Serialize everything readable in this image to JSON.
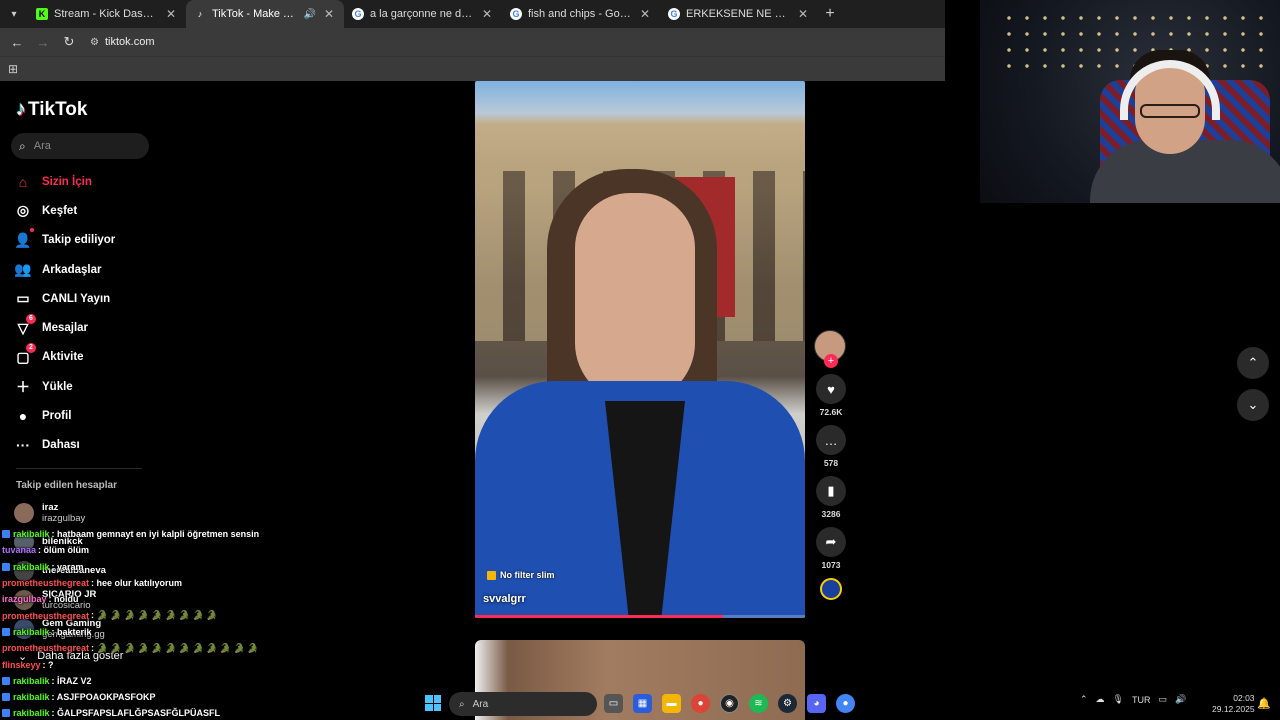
{
  "browser": {
    "tabs": [
      {
        "label": "Stream - Kick Dashboard",
        "icon": "kick-icon",
        "color": "#53fc18"
      },
      {
        "label": "TikTok - Make Your Day",
        "icon": "tiktok-icon",
        "color": "#ffffff",
        "active": true
      },
      {
        "label": "a la garçonne ne demek amk -",
        "icon": "google-icon",
        "color": "#4285f4"
      },
      {
        "label": "fish and chips - Google'da Ara",
        "icon": "google-icon",
        "color": "#4285f4"
      },
      {
        "label": "ERKEKSENE NE DEMEK - Googl",
        "icon": "google-icon",
        "color": "#4285f4"
      }
    ],
    "url": "tiktok.com"
  },
  "sidebar": {
    "brand": "TikTok",
    "search_placeholder": "Ara",
    "items": [
      {
        "label": "Sizin İçin",
        "icon": "home-icon",
        "active": true
      },
      {
        "label": "Keşfet",
        "icon": "compass-icon"
      },
      {
        "label": "Takip ediliyor",
        "icon": "following-icon",
        "dot": true
      },
      {
        "label": "Arkadaşlar",
        "icon": "friends-icon"
      },
      {
        "label": "CANLI Yayın",
        "icon": "live-icon"
      },
      {
        "label": "Mesajlar",
        "icon": "messages-icon",
        "badge": "6"
      },
      {
        "label": "Aktivite",
        "icon": "activity-icon",
        "badge": "2"
      },
      {
        "label": "Yükle",
        "icon": "upload-icon"
      },
      {
        "label": "Profil",
        "icon": "profile-icon"
      },
      {
        "label": "Dahası",
        "icon": "more-icon"
      }
    ],
    "following_title": "Takip edilen hesaplar",
    "following": [
      {
        "user": "iraz",
        "name": "irazgulbay"
      },
      {
        "user": "bilenikck",
        "name": ""
      },
      {
        "user": "therealbaneva",
        "name": ""
      },
      {
        "user": "SICARIO JR",
        "name": "turcosicario"
      },
      {
        "user": "Gem Gaming",
        "name": "gemgaming.gg"
      }
    ],
    "more_label": "Daha fazla göster"
  },
  "chat": [
    {
      "user": "rakibalik",
      "color": "#53fc18",
      "msg": ": hatbaam gemnayt en iyi kalpli öğretmen sensin",
      "badge": true
    },
    {
      "user": "tuvanaa",
      "color": "#b36bff",
      "msg": ": ölüm ölüm",
      "badge": false
    },
    {
      "user": "rakibalik",
      "color": "#53fc18",
      "msg": ": yaram",
      "badge": true
    },
    {
      "user": "prometheusthegreat",
      "color": "#ff4d4d",
      "msg": ": hee olur katılıyorum",
      "badge": false
    },
    {
      "user": "irazgulbay",
      "color": "#ff6fd1",
      "msg": ": noldu",
      "badge": false
    },
    {
      "user": "prometheusthegreat",
      "color": "#ff4d4d",
      "msg": ": 🐊 🐊 🐊 🐊 🐊 🐊 🐊 🐊 🐊",
      "badge": false
    },
    {
      "user": "rakibalik",
      "color": "#53fc18",
      "msg": ": bakterik",
      "badge": true
    },
    {
      "user": "prometheusthegreat",
      "color": "#ff4d4d",
      "msg": ": 🐊 🐊 🐊 🐊 🐊 🐊 🐊 🐊 🐊 🐊 🐊 🐊",
      "badge": false
    },
    {
      "user": "flinskeyy",
      "color": "#ff4d4d",
      "msg": ": ?",
      "badge": false
    },
    {
      "user": "rakibalik",
      "color": "#53fc18",
      "msg": ": İRAZ V2",
      "badge": true
    },
    {
      "user": "rakibalik",
      "color": "#53fc18",
      "msg": ": ASJFPOAOKPASFOKP",
      "badge": true
    },
    {
      "user": "rakibalik",
      "color": "#53fc18",
      "msg": ": ĞALPSFAPSLAFLĞPSASFĞLPÜASFL",
      "badge": true
    }
  ],
  "video": {
    "tag": "No filter slim",
    "author": "svvalgrr",
    "progress": 0.75,
    "actions": {
      "likes": "72.6K",
      "comments": "578",
      "saves": "3286",
      "shares": "1073"
    }
  },
  "taskbar": {
    "search_placeholder": "Ara",
    "language": "TUR",
    "time": "02:03",
    "date": "29.12.2025"
  }
}
